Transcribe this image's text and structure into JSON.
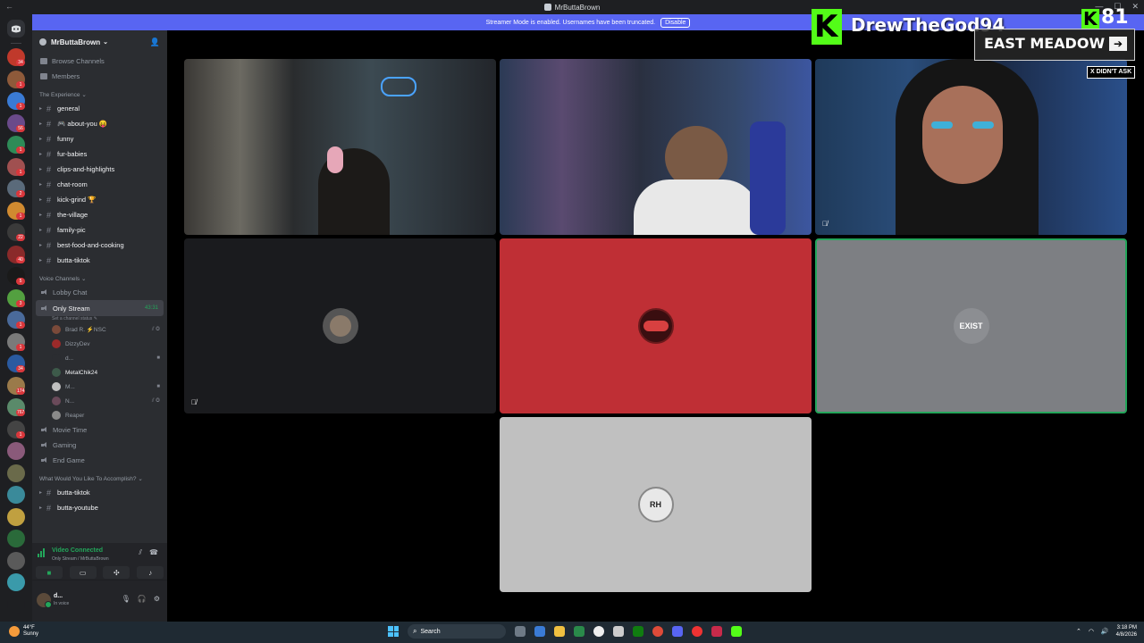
{
  "window": {
    "title": "MrButtaBrown"
  },
  "banner": {
    "text": "Streamer Mode is enabled. Usernames have been truncated.",
    "button_label": "Disable"
  },
  "server": {
    "name": "MrButtaBrown"
  },
  "nav": {
    "browse": "Browse Channels",
    "members": "Members"
  },
  "categories": {
    "experience": "The Experience",
    "voice": "Voice Channels",
    "accomplish": "What Would You Like To Accomplish?"
  },
  "channels": [
    {
      "name": "general"
    },
    {
      "name": "🎮 about-you 😝"
    },
    {
      "name": "funny"
    },
    {
      "name": "fur-babies"
    },
    {
      "name": "clips-and-highlights"
    },
    {
      "name": "chat-room"
    },
    {
      "name": "kick-grind 🏆"
    },
    {
      "name": "the-village"
    },
    {
      "name": "family-pic"
    },
    {
      "name": "best-food-and-cooking"
    },
    {
      "name": "butta-tiktok"
    }
  ],
  "voice_channels": {
    "lobby": "Lobby Chat",
    "only_stream": {
      "name": "Only Stream",
      "timer": "43:31",
      "status": "Set a channel status ✎"
    },
    "users": [
      {
        "name": "Brad R. ⚡NSC",
        "color": "#7a4a3a"
      },
      {
        "name": "DizzyDev",
        "color": "#9b2a2a"
      },
      {
        "name": "d...",
        "color": "#2b2d31"
      },
      {
        "name": "MetalChik24",
        "color": "#3d5a4a"
      },
      {
        "name": "M...",
        "color": "#c0c0c0"
      },
      {
        "name": "N...",
        "color": "#6a4a5a"
      },
      {
        "name": "Reaper",
        "color": "#8a8a8a"
      }
    ],
    "others": [
      "Movie Time",
      "Gaming",
      "End Game"
    ]
  },
  "bottom_channels": [
    {
      "name": "butta-tiktok"
    },
    {
      "name": "butta-youtube"
    }
  ],
  "voice_panel": {
    "title": "Video Connected",
    "sub": "Only Stream / MrButtaBrown"
  },
  "user_panel": {
    "name": "d...",
    "status": "In voice"
  },
  "tiles": [
    {
      "avatar_text": "",
      "bg": "#1a1b1e"
    },
    {
      "avatar_text": "",
      "bg": "#bf2f35"
    },
    {
      "avatar_text": "EXIST",
      "bg": "#7d7f83"
    },
    {
      "avatar_text": "RH",
      "bg": "#c0c0c0"
    }
  ],
  "overlay": {
    "k_letter": "K",
    "streamer": "DrewTheGod94",
    "viewers": "81",
    "meadow": "EAST MEADOW",
    "didnt_ask": "X DIDN'T ASK"
  },
  "taskbar": {
    "weather_temp": "44°F",
    "weather_cond": "Sunny",
    "search": "Search",
    "time": "3:18 PM",
    "date": "4/8/2026"
  },
  "rail_badges": [
    "34",
    "1",
    "1",
    "56",
    "1",
    "1",
    "2",
    "1",
    "22",
    "40",
    "5",
    "3",
    "1",
    "1",
    "34",
    "174",
    "767",
    "1"
  ]
}
